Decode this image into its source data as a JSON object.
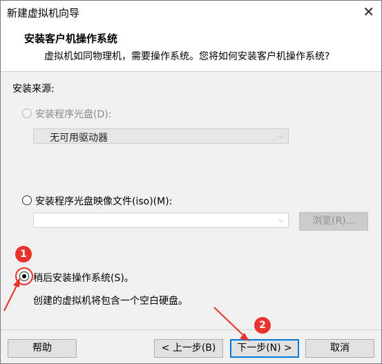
{
  "window": {
    "title": "新建虚拟机向导",
    "close_glyph": "✕"
  },
  "header": {
    "title": "安装客户机操作系统",
    "subtitle": "虚拟机如同物理机，需要操作系统。您将如何安装客户机操作系统?"
  },
  "source": {
    "label": "安装来源:"
  },
  "options": {
    "disc": {
      "label": "安装程序光盘(D):",
      "selected": false,
      "enabled": false,
      "drive_value": "无可用驱动器"
    },
    "iso": {
      "label": "安装程序光盘映像文件(iso)(M):",
      "selected": false,
      "enabled": true,
      "path_value": "",
      "browse_label": "浏览(R)..."
    },
    "later": {
      "label": "稍后安装操作系统(S)。",
      "selected": true,
      "enabled": true,
      "description": "创建的虚拟机将包含一个空白硬盘。"
    }
  },
  "footer": {
    "help_label": "帮助",
    "back_label": "< 上一步(B)",
    "next_label": "下一步(N) >",
    "cancel_label": "取消"
  },
  "annotations": {
    "step1": "1",
    "step2": "2",
    "color": "#e8322b"
  },
  "icons": {
    "chevron": "chevron-down-icon",
    "close": "close-icon"
  }
}
